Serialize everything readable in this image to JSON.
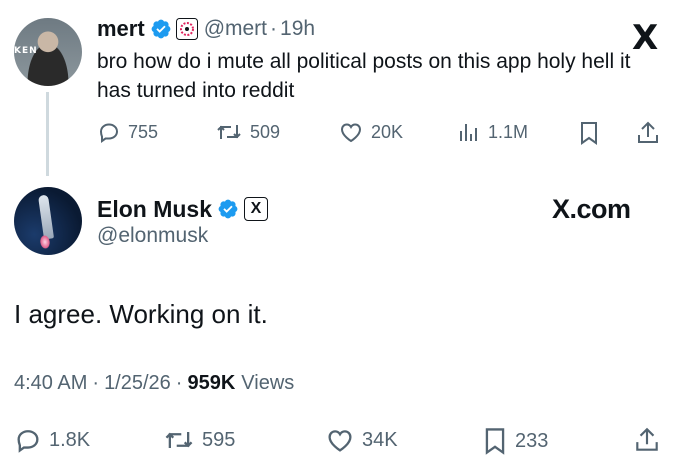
{
  "reply_context": {
    "author_name": "mert",
    "author_handle": "@mert",
    "separator": "·",
    "time_ago": "19h",
    "avatar_sign_text": "KEN",
    "text": "bro how do i mute all political posts on this app holy hell it has turned into reddit",
    "actions": {
      "replies": "755",
      "reposts": "509",
      "likes": "20K",
      "views": "1.1M"
    }
  },
  "platform_logo": "X",
  "main_post": {
    "author_name": "Elon Musk",
    "author_handle": "@elonmusk",
    "affiliate_badge": "X",
    "domain_label": "X.com",
    "text": "I agree. Working on it.",
    "time": "4:40 AM",
    "date": "1/25/26",
    "separator": "·",
    "views_count": "959K",
    "views_label": "Views",
    "actions": {
      "replies": "1.8K",
      "reposts": "595",
      "likes": "34K",
      "bookmarks": "233"
    }
  },
  "colors": {
    "verified_blue": "#1d9bf0",
    "text_primary": "#0f1419",
    "text_secondary": "#536471",
    "thread_line": "#cfd9de"
  }
}
